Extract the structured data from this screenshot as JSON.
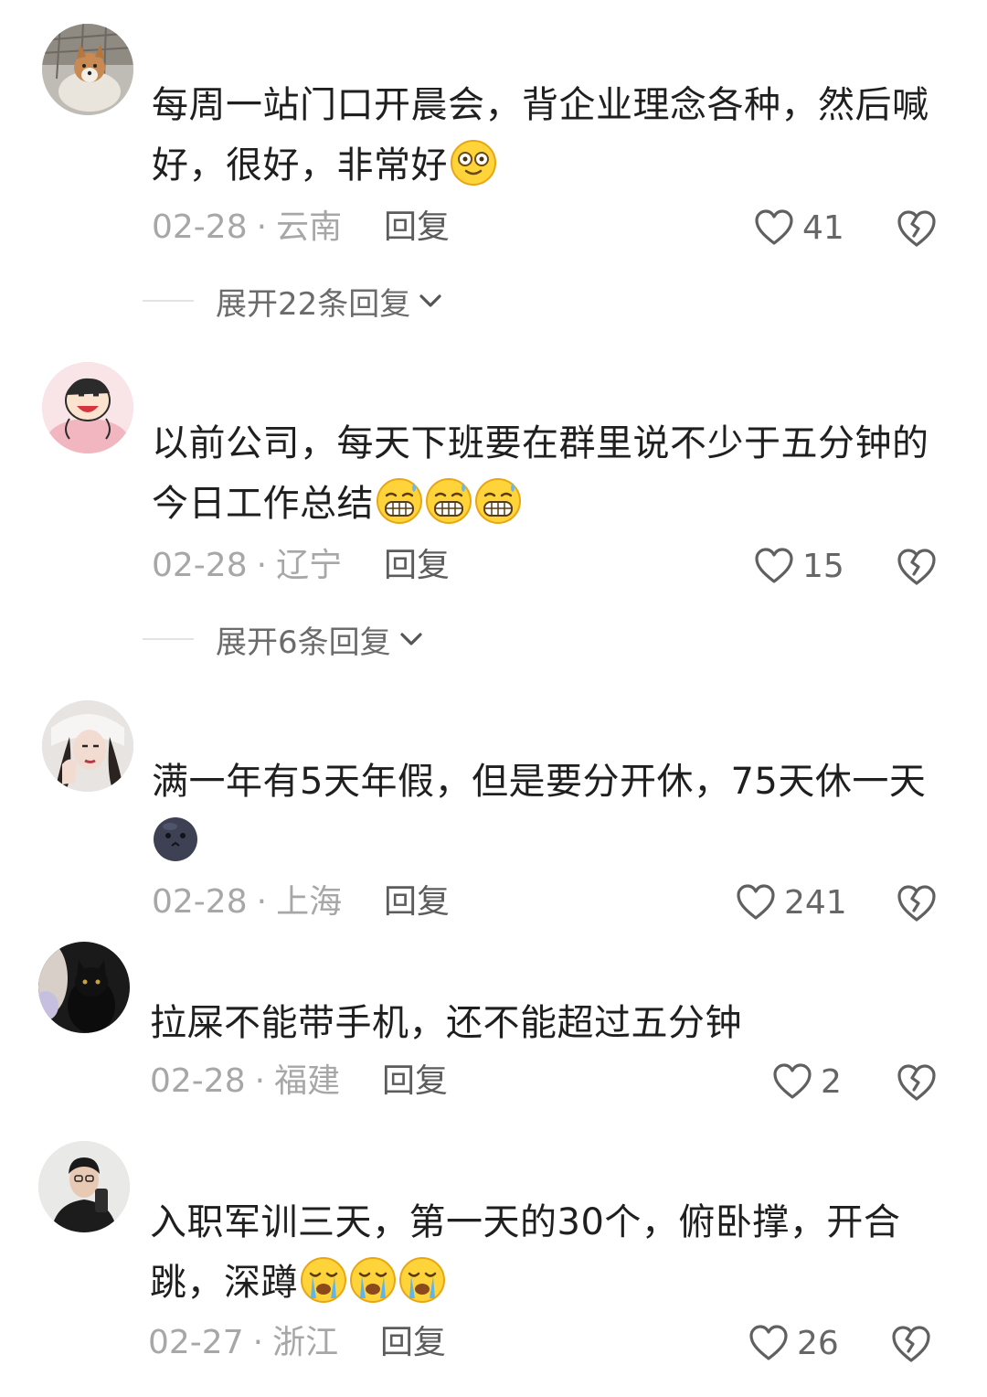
{
  "comments": [
    {
      "text": "每周一站门口开晨会，背企业理念各种，然后喊好，很好，非常好",
      "emojis": [
        "dizzy-face-emoji"
      ],
      "date": "02-28",
      "region": "云南",
      "reply_label": "回复",
      "likes": "41",
      "expand_label": "展开22条回复"
    },
    {
      "text": "以前公司，每天下班要在群里说不少于五分钟的今日工作总结",
      "emojis": [
        "grin-sweat-emoji",
        "grin-sweat-emoji",
        "grin-sweat-emoji"
      ],
      "date": "02-28",
      "region": "辽宁",
      "reply_label": "回复",
      "likes": "15",
      "expand_label": "展开6条回复"
    },
    {
      "text": "满一年有5天年假，但是要分开休，75天休一天",
      "emojis": [
        "dark-face-emoji"
      ],
      "date": "02-28",
      "region": "上海",
      "reply_label": "回复",
      "likes": "241"
    },
    {
      "text": "拉屎不能带手机，还不能超过五分钟",
      "emojis": [],
      "date": "02-28",
      "region": "福建",
      "reply_label": "回复",
      "likes": "2"
    },
    {
      "text": "入职军训三天，第一天的30个，俯卧撑，开合跳，深蹲",
      "emojis": [
        "crying-face-emoji",
        "crying-face-emoji",
        "crying-face-emoji"
      ],
      "date": "02-27",
      "region": "浙江",
      "reply_label": "回复",
      "likes": "26"
    }
  ],
  "separator": "·",
  "icons": {
    "like": "heart-outline-icon",
    "dislike": "broken-heart-icon",
    "expand": "chevron-down-icon"
  },
  "colors": {
    "text": "#1f1f1f",
    "meta": "#a7a7a7",
    "reply": "#5c5c5c"
  }
}
